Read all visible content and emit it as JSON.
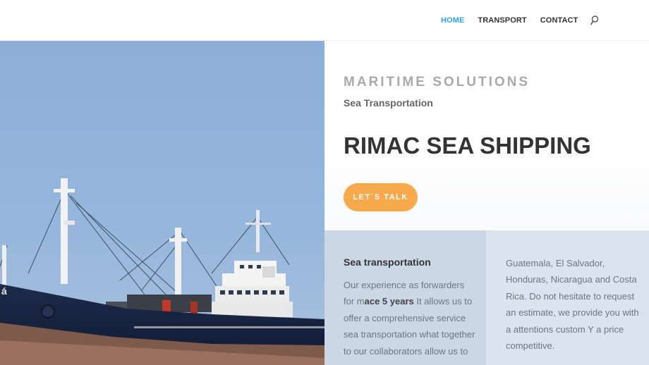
{
  "nav": {
    "items": [
      {
        "label": "HOME",
        "active": true
      },
      {
        "label": "TRANSPORT",
        "active": false
      },
      {
        "label": "CONTACT",
        "active": false
      }
    ],
    "active_color": "#2ea3f2",
    "search_icon": "search-icon"
  },
  "hero": {
    "overline": "MARITIME SOLUTIONS",
    "subline": "Sea Transportation",
    "headline": "RIMAC SEA SHIPPING",
    "cta_label": "LET´S TALK",
    "cta_color": "#f8a94c"
  },
  "col_left": {
    "title": "Sea transportation",
    "text_pre": "Our experience as forwarders for m",
    "text_bold": "ace 5 years",
    "text_post": " It allows us to offer a comprehensive service sea transportation what together to our collaborators allow us to"
  },
  "col_right": {
    "text": "Guatemala, El Salvador, Honduras, Nicaragua and Costa Rica. Do not hesitate to request an estimate, we provide you with a attentions custom Y a price competitive."
  },
  "colors": {
    "col_left_bg": "#cbd7e5",
    "col_right_bg": "#dbe3ee",
    "sky": "#8db0d8"
  }
}
